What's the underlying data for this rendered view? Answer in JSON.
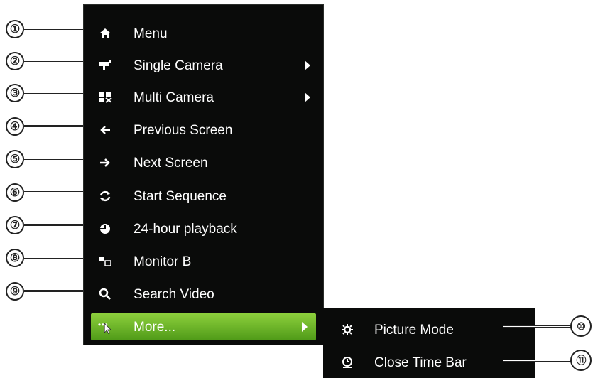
{
  "menu": {
    "items": [
      {
        "label": "Menu",
        "icon": "home-icon",
        "has_submenu": false
      },
      {
        "label": "Single Camera",
        "icon": "camera-icon",
        "has_submenu": true
      },
      {
        "label": "Multi Camera",
        "icon": "multi-camera-icon",
        "has_submenu": true
      },
      {
        "label": "Previous Screen",
        "icon": "arrow-left-icon",
        "has_submenu": false
      },
      {
        "label": "Next Screen",
        "icon": "arrow-right-icon",
        "has_submenu": false
      },
      {
        "label": "Start Sequence",
        "icon": "refresh-icon",
        "has_submenu": false
      },
      {
        "label": "24-hour playback",
        "icon": "playback-icon",
        "has_submenu": false
      },
      {
        "label": "Monitor B",
        "icon": "monitor-icon",
        "has_submenu": false
      },
      {
        "label": "Search Video",
        "icon": "search-icon",
        "has_submenu": false
      },
      {
        "label": "More...",
        "icon": "more-icon",
        "has_submenu": true,
        "highlighted": true
      }
    ]
  },
  "submenu": {
    "items": [
      {
        "label": "Picture Mode",
        "icon": "gear-icon"
      },
      {
        "label": "Close Time Bar",
        "icon": "clock-icon"
      }
    ]
  },
  "callouts": [
    "①",
    "②",
    "③",
    "④",
    "⑤",
    "⑥",
    "⑦",
    "⑧",
    "⑨",
    "⑩",
    "⑪"
  ],
  "colors": {
    "menu_bg": "#0a0b0a",
    "highlight_top": "#8dd03c",
    "highlight_bottom": "#4f9a18",
    "text": "#ffffff"
  }
}
